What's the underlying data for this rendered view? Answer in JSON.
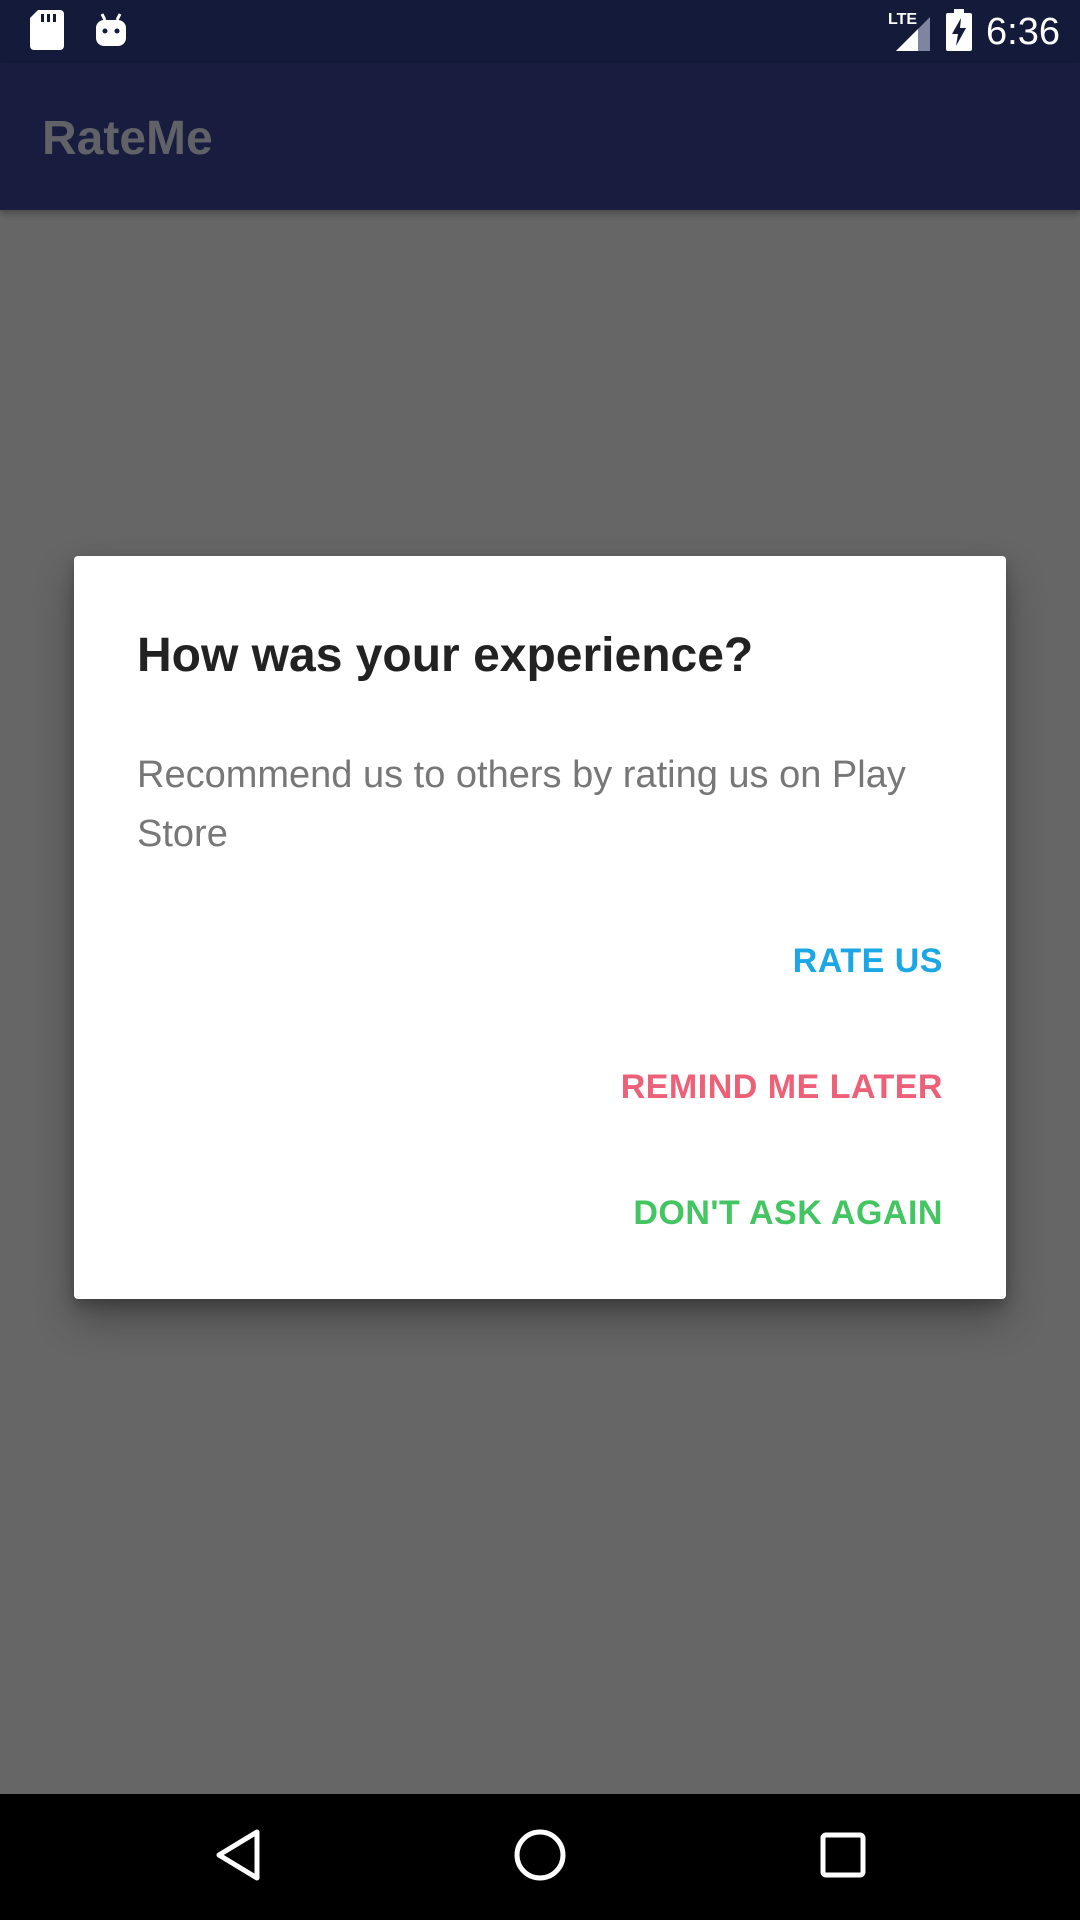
{
  "status_bar": {
    "time": "6:36",
    "network_label": "LTE",
    "icons": [
      "sd-card-icon",
      "android-icon",
      "signal-icon",
      "battery-charging-icon"
    ]
  },
  "app_bar": {
    "title": "RateMe"
  },
  "dialog": {
    "title": "How was your experience?",
    "message": "Recommend us to others by rating us on Play Store",
    "actions": {
      "rate": "RATE US",
      "remind": "REMIND ME LATER",
      "dont_ask": "DON'T ASK AGAIN"
    }
  },
  "nav_bar": {
    "icons": [
      "back-icon",
      "home-icon",
      "recent-apps-icon"
    ]
  },
  "colors": {
    "status_bar": "#141a3a",
    "app_bar": "#181c3e",
    "scrim": "#666666",
    "rate_us": "#1ba7e5",
    "remind_me_later": "#ee6077",
    "dont_ask_again": "#43c561"
  }
}
